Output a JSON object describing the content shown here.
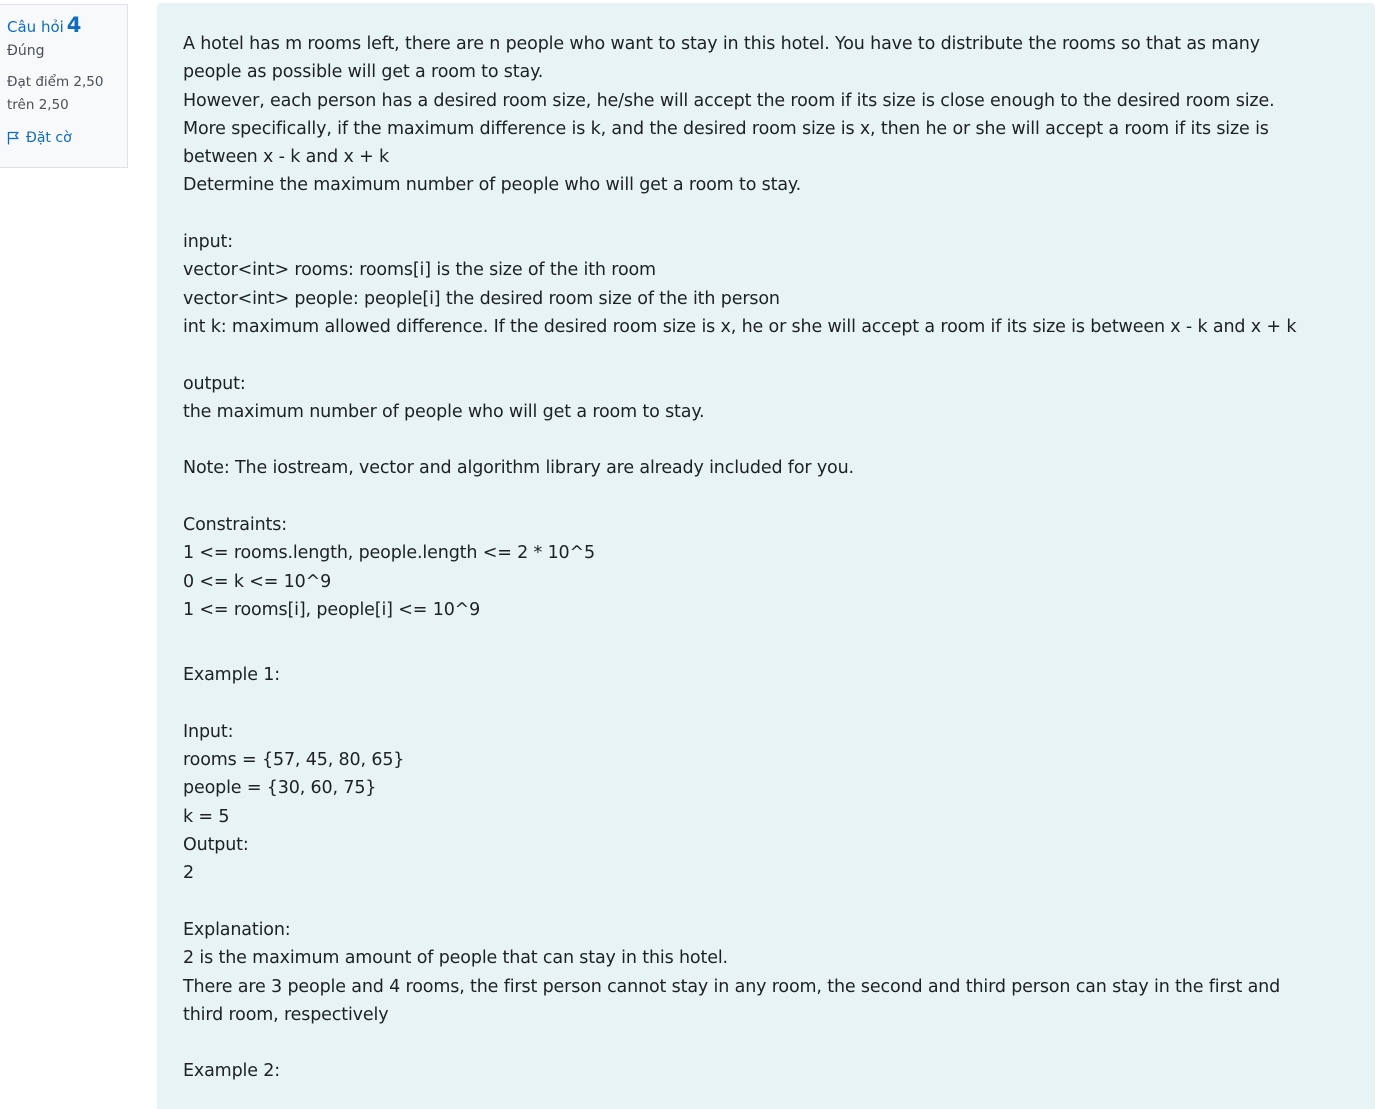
{
  "info": {
    "question_label": "Câu hỏi",
    "question_number": "4",
    "state": "Đúng",
    "grade_line1": "Đạt điểm 2,50",
    "grade_line2": "trên 2,50",
    "flag_label": "Đặt cờ"
  },
  "question": {
    "lines": [
      "A hotel has m rooms left, there are n people who want to stay in this hotel. You have to distribute the rooms so that as many",
      "people as possible will get a room to stay.",
      "However, each person has a desired room size, he/she will accept the room if its size is close enough to the desired room size.",
      "More specifically, if the maximum difference is k, and the desired room size is x, then he or she will accept a room if its size is",
      "between x - k and x + k",
      "Determine the maximum number of people who will get a room to stay.",
      "",
      "input:",
      "vector<int> rooms: rooms[i] is the size of the ith room",
      "vector<int> people: people[i] the desired room size of the ith person",
      "int k: maximum allowed difference. If the desired room size is x, he or she will accept a room if its size is between x - k and x + k",
      "",
      "output:",
      "the maximum number of people who will get a room to stay.",
      "",
      "Note: The iostream, vector and algorithm library are already included for you.",
      "",
      "Constraints:",
      "1 <= rooms.length, people.length <= 2 * 10^5",
      "0 <= k <= 10^9",
      "1 <= rooms[i], people[i] <= 10^9",
      "",
      "Example 1:",
      "",
      "Input:",
      "rooms = {57, 45, 80, 65}",
      "people = {30, 60, 75}",
      "k = 5",
      "Output:",
      "2",
      "",
      "Explanation:",
      "2 is the maximum amount of people that can stay in this hotel.",
      "There are 3 people and 4 rooms, the first person cannot stay in any room, the second and third person can stay in the first and",
      "third room, respectively",
      "",
      "Example 2:"
    ]
  }
}
